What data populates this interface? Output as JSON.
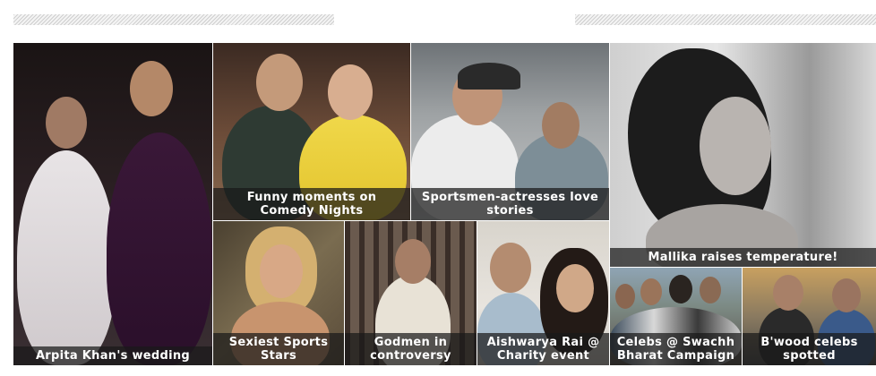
{
  "gallery": {
    "tiles": [
      {
        "caption_1": "Arpita Khan's wedding"
      },
      {
        "caption_1": "Funny moments on",
        "caption_2": "Comedy Nights"
      },
      {
        "caption_1": "Sportsmen-actresses love",
        "caption_2": "stories"
      },
      {
        "caption_1": "Mallika raises temperature!"
      },
      {
        "caption_1": "Sexiest Sports",
        "caption_2": "Stars"
      },
      {
        "caption_1": "Godmen in",
        "caption_2": "controversy"
      },
      {
        "caption_1": "Aishwarya Rai @",
        "caption_2": "Charity event"
      },
      {
        "caption_1": "Celebs @ Swachh",
        "caption_2": "Bharat Campaign"
      },
      {
        "caption_1": "B'wood celebs",
        "caption_2": "spotted"
      }
    ]
  }
}
